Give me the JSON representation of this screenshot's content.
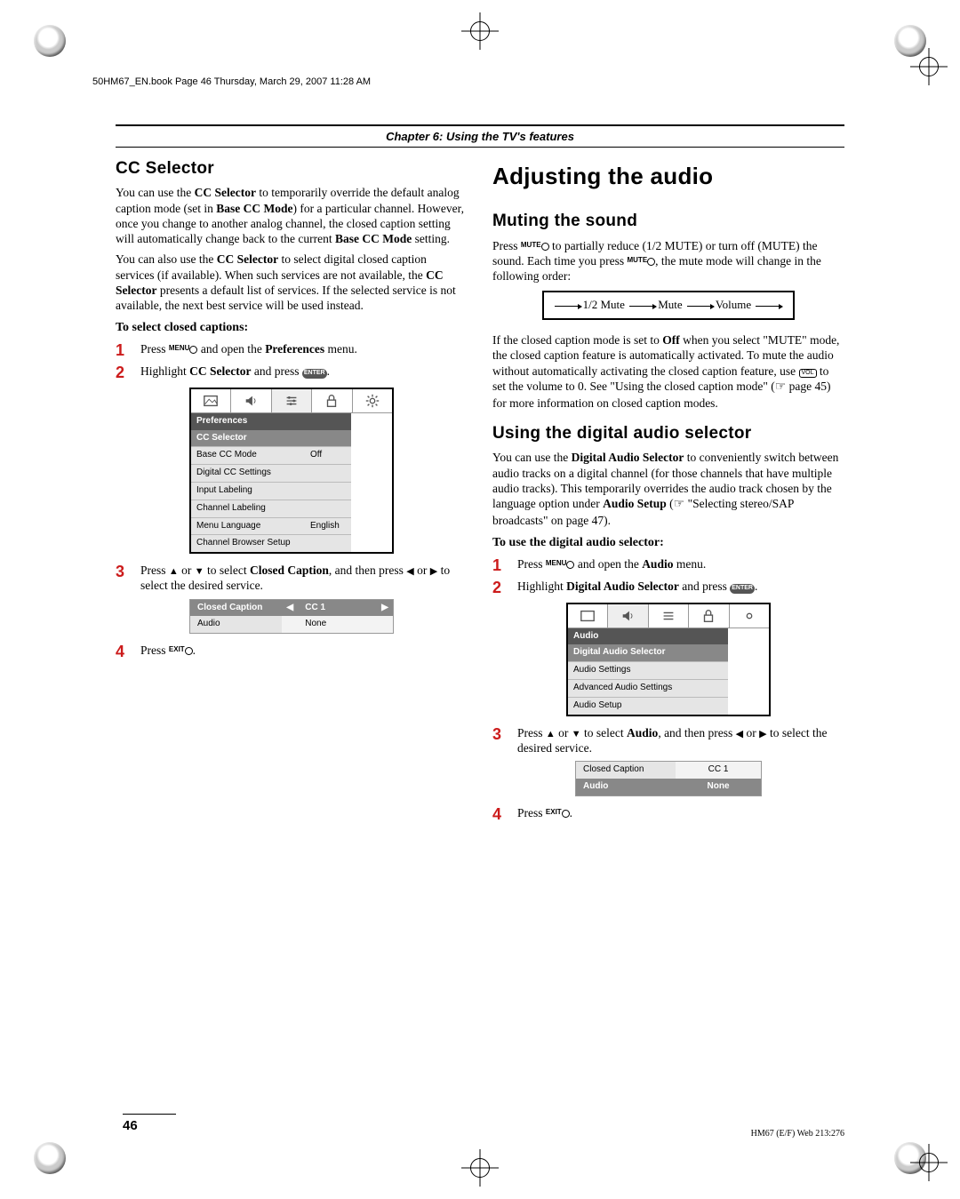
{
  "header_note": "50HM67_EN.book  Page 46  Thursday, March 29, 2007  11:28 AM",
  "chapter": "Chapter 6: Using the TV's features",
  "left": {
    "title": "CC Selector",
    "para1a": "You can use the ",
    "para1b": " to temporarily override the default analog caption mode (set in ",
    "para1c": ") for a particular channel. However, once you change to another analog channel, the closed caption setting will automatically change back to the current ",
    "para1d": " setting.",
    "bold_cc_selector": "CC Selector",
    "bold_base_cc_mode": "Base CC Mode",
    "para2a": "You can also use the ",
    "para2b": " to select digital closed caption services (if available). When such services are not available, the ",
    "para2c": " presents a default list of services. If the selected service is not available, the next best service will be used instead.",
    "subhead": "To select closed captions:",
    "step1a": "Press ",
    "step1b": " and open the ",
    "step1c": " menu.",
    "bold_preferences": "Preferences",
    "menu_label": "MENU",
    "step2a": "Highlight ",
    "step2b": " and press ",
    "step2c": ".",
    "enter_label": "ENTER",
    "menu": {
      "header": "Preferences",
      "selected": "CC Selector",
      "rows": [
        {
          "label": "Base CC Mode",
          "value": "Off"
        },
        {
          "label": "Digital CC Settings",
          "value": ""
        },
        {
          "label": "Input Labeling",
          "value": ""
        },
        {
          "label": "Channel Labeling",
          "value": ""
        },
        {
          "label": "Menu Language",
          "value": "English"
        },
        {
          "label": "Channel Browser Setup",
          "value": ""
        }
      ]
    },
    "step3a": "Press ",
    "step3b": " or ",
    "step3c": " to select ",
    "step3d": ", and then press ",
    "step3e": " or ",
    "step3f": " to select the desired service.",
    "bold_closed_caption": "Closed Caption",
    "strip": {
      "row1": {
        "label": "Closed Caption",
        "left": "◀",
        "value": "CC 1",
        "right": "▶"
      },
      "row2": {
        "label": "Audio",
        "value": "None"
      }
    },
    "step4a": "Press ",
    "step4b": ".",
    "exit_label": "EXIT"
  },
  "right": {
    "title_big": "Adjusting the audio",
    "sec1_title": "Muting the sound",
    "sec1_p1a": "Press ",
    "sec1_p1b": " to partially reduce (1/2 MUTE) or turn off (MUTE) the sound. Each time you press ",
    "sec1_p1c": ", the mute mode will change in the following order:",
    "mute_label": "MUTE",
    "flow": {
      "a": "1/2 Mute",
      "b": "Mute",
      "c": "Volume"
    },
    "sec1_p2a": "If the closed caption mode is set to ",
    "sec1_p2_off": "Off",
    "sec1_p2b": " when you select \"MUTE\" mode, the closed caption feature is automatically activated. To mute the audio without automatically activating the closed caption feature, use ",
    "sec1_p2c": " to set the volume to 0. See \"Using the closed caption mode\" (",
    "sec1_p2d": " page 45) for more information on closed caption modes.",
    "vol_label": "VOL",
    "ptr": "☞",
    "sec2_title": "Using the digital audio selector",
    "sec2_p1a": "You can use the ",
    "sec2_p1_bold": "Digital Audio Selector",
    "sec2_p1b": " to conveniently switch between audio tracks on a digital channel (for those channels that have multiple audio tracks). This temporarily overrides the audio track chosen by the language option under ",
    "sec2_p1_bold2": "Audio Setup",
    "sec2_p1c": " (",
    "sec2_p1d": " \"Selecting stereo/SAP broadcasts\" on page 47).",
    "sec2_sub": "To use the digital audio selector:",
    "r_step1a": "Press ",
    "r_step1b": " and open the ",
    "r_step1c": " menu.",
    "bold_audio": "Audio",
    "r_step2a": "Highlight ",
    "r_step2b": " and press ",
    "r_step2c": ".",
    "menu2": {
      "header": "Audio",
      "selected": "Digital Audio Selector",
      "rows": [
        {
          "label": "Audio Settings"
        },
        {
          "label": "Advanced Audio Settings"
        },
        {
          "label": "Audio Setup"
        }
      ]
    },
    "r_step3a": "Press ",
    "r_step3b": " or ",
    "r_step3c": " to select ",
    "r_step3d": ", and then press ",
    "r_step3e": " or ",
    "r_step3f": " to select the desired service.",
    "strip2": {
      "row1": {
        "label": "Closed Caption",
        "value": "CC 1"
      },
      "row2": {
        "label": "Audio",
        "value": "None"
      }
    },
    "r_step4a": "Press ",
    "r_step4b": "."
  },
  "page_number": "46",
  "footer_right": "HM67 (E/F) Web 213:276"
}
